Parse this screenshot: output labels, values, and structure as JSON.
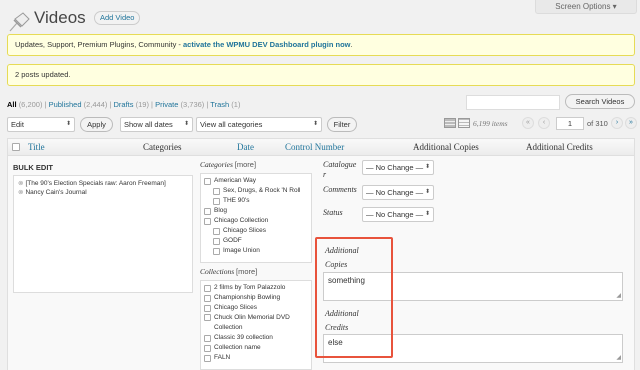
{
  "header": {
    "screen_options": "Screen Options ▾",
    "title": "Videos",
    "add_button": "Add Video"
  },
  "notices": {
    "upsell_prefix": "Updates, Support, Premium Plugins, Community - ",
    "upsell_link": "activate the WPMU DEV Dashboard plugin now",
    "upsell_suffix": ".",
    "updated": "2 posts updated."
  },
  "status_links": [
    {
      "label": "All",
      "count": "(6,200)",
      "current": true
    },
    {
      "label": "Published",
      "count": "(2,444)",
      "current": false
    },
    {
      "label": "Drafts",
      "count": "(19)",
      "current": false
    },
    {
      "label": "Private",
      "count": "(3,736)",
      "current": false
    },
    {
      "label": "Trash",
      "count": "(1)",
      "current": false
    }
  ],
  "search": {
    "value": "",
    "button": "Search Videos"
  },
  "tablenav": {
    "bulk_action": "Edit",
    "apply": "Apply",
    "date_filter": "Show all dates",
    "category_filter": "View all categories",
    "filter": "Filter",
    "items": "6,199 items",
    "first": "«",
    "prev": "‹",
    "current_page": "1",
    "total_pages": "of 310",
    "next": "›",
    "last": "»"
  },
  "columns": {
    "title": "Title",
    "categories": "Categories",
    "date": "Date",
    "control_number": "Control Number",
    "additional_copies": "Additional Copies",
    "additional_credits": "Additional Credits"
  },
  "bulk_edit": {
    "heading": "BULK EDIT",
    "posts": [
      "[The 90's Election Specials raw: Aaron Freeman]",
      "Nancy Cain's Journal"
    ],
    "categories_label": "Categories",
    "more": "[more]",
    "categories": [
      {
        "label": "American Way",
        "child": false
      },
      {
        "label": "Sex, Drugs, & Rock 'N Roll",
        "child": true
      },
      {
        "label": "THE 90's",
        "child": true
      },
      {
        "label": "Blog",
        "child": false
      },
      {
        "label": "Chicago Collection",
        "child": false
      },
      {
        "label": "Chicago Slices",
        "child": true
      },
      {
        "label": "GODF",
        "child": true
      },
      {
        "label": "Image Union",
        "child": true
      }
    ],
    "collections_label": "Collections",
    "collections": [
      "2 films by Tom Palazzolo",
      "Championship Bowling",
      "Chicago Slices",
      "Chuck Olin Memorial DVD Collection",
      "Classic 39 collection",
      "Collection name",
      "FALN"
    ],
    "catalogue_label": "Catalogue",
    "catalogue_label_wrap": "r",
    "catalogue_value": "— No Change —",
    "comments_label": "Comments",
    "comments_value": "— No Change —",
    "status_label": "Status",
    "status_value": "— No Change —",
    "copies_label_1": "Additional",
    "copies_label_2": "Copies",
    "copies_value": "something",
    "credits_label_1": "Additional",
    "credits_label_2": "Credits",
    "credits_value": "else"
  },
  "colors": {
    "link": "#21759b",
    "notice_bg": "#ffffe0",
    "notice_border": "#e6db55",
    "highlight": "#e8533c"
  }
}
